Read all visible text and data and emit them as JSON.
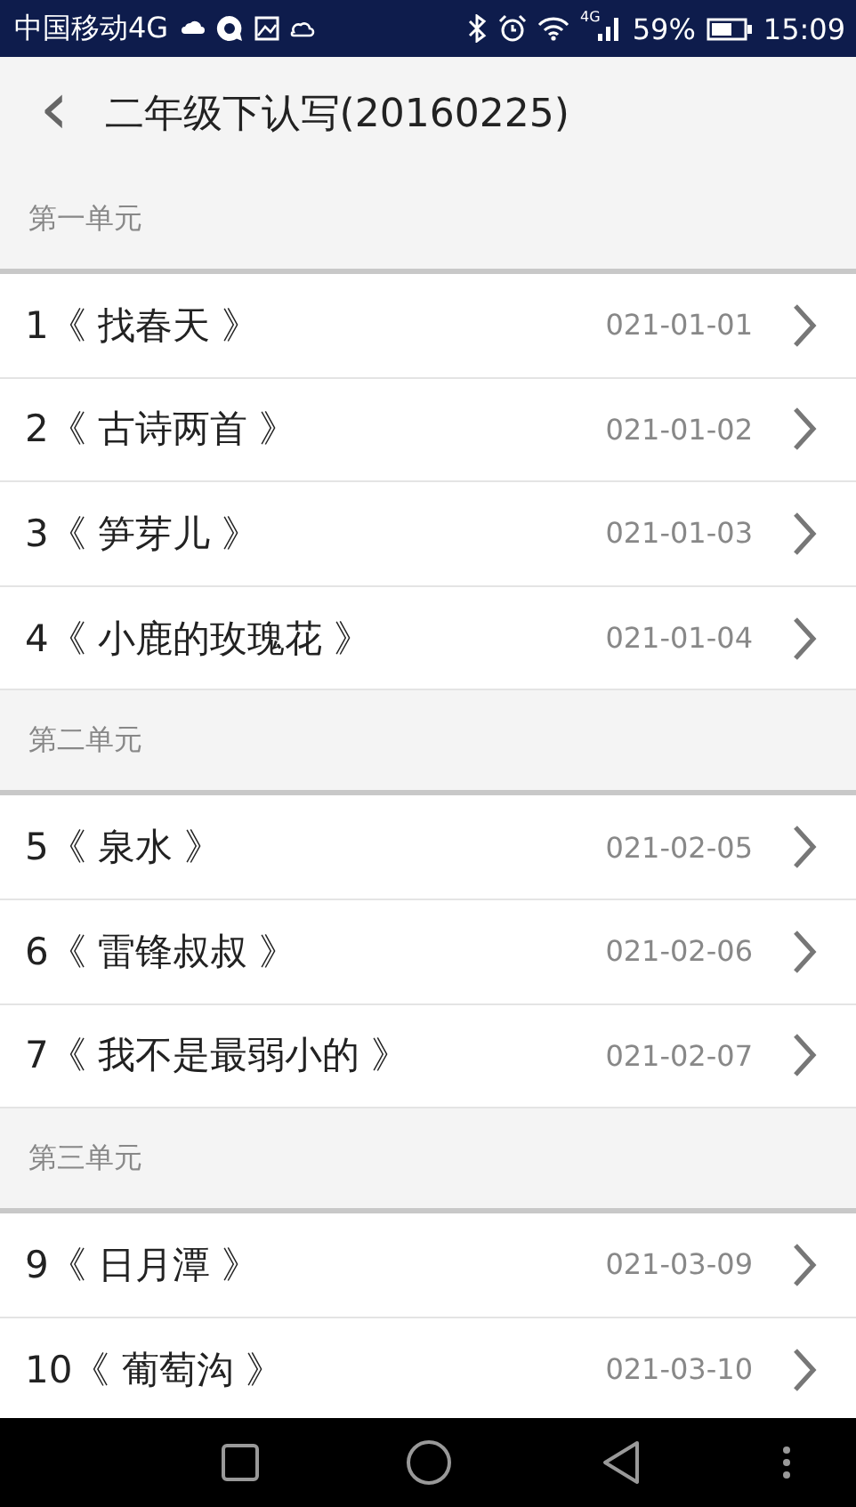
{
  "status_bar": {
    "carrier": "中国移动4G",
    "network": "4G",
    "battery": "59%",
    "time": "15:09"
  },
  "header": {
    "back": "‹",
    "title": "二年级下认写(20160225)"
  },
  "sections": [
    {
      "title": "第一单元",
      "items": [
        {
          "label": "1《 找春天 》",
          "code": "021-01-01"
        },
        {
          "label": "2《 古诗两首 》",
          "code": "021-01-02"
        },
        {
          "label": "3《 笋芽儿 》",
          "code": "021-01-03"
        },
        {
          "label": "4《 小鹿的玫瑰花 》",
          "code": "021-01-04"
        }
      ]
    },
    {
      "title": "第二单元",
      "items": [
        {
          "label": "5《 泉水 》",
          "code": "021-02-05"
        },
        {
          "label": "6《 雷锋叔叔 》",
          "code": "021-02-06"
        },
        {
          "label": "7《 我不是最弱小的 》",
          "code": "021-02-07"
        }
      ]
    },
    {
      "title": "第三单元",
      "items": [
        {
          "label": "9《 日月潭 》",
          "code": "021-03-09"
        },
        {
          "label": "10《 葡萄沟 》",
          "code": "021-03-10"
        }
      ]
    }
  ]
}
